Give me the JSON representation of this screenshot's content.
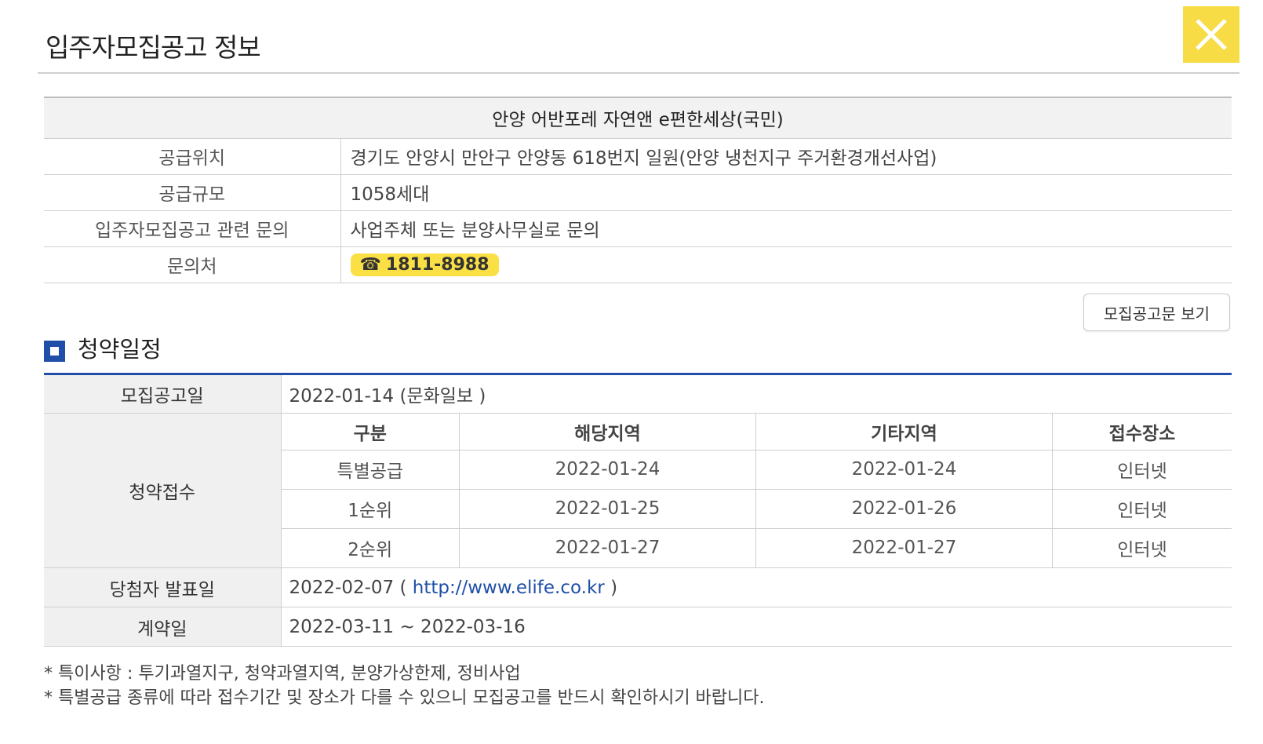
{
  "header": {
    "title": "입주자모집공고 정보"
  },
  "info": {
    "complex_name": "안양 어반포레 자연앤 e편한세상(국민)",
    "rows": [
      {
        "label": "공급위치",
        "value": "경기도 안양시 만안구 안양동 618번지 일원(안양 냉천지구 주거환경개선사업)"
      },
      {
        "label": "공급규모",
        "value": "1058세대"
      },
      {
        "label": "입주자모집공고 관련 문의",
        "value": "사업주체 또는 분양사무실로 문의"
      }
    ],
    "contact_label": "문의처",
    "phone_icon": "☎",
    "phone": "1811-8988"
  },
  "view_notice_label": "모집공고문 보기",
  "schedule": {
    "section_title": "청약일정",
    "announcement_label": "모집공고일",
    "announcement_value": "2022-01-14 (문화일보 )",
    "subscription_label": "청약접수",
    "columns": [
      "구분",
      "해당지역",
      "기타지역",
      "접수장소"
    ],
    "rows": [
      [
        "특별공급",
        "2022-01-24",
        "2022-01-24",
        "인터넷"
      ],
      [
        "1순위",
        "2022-01-25",
        "2022-01-26",
        "인터넷"
      ],
      [
        "2순위",
        "2022-01-27",
        "2022-01-27",
        "인터넷"
      ]
    ],
    "winner_label": "당첨자 발표일",
    "winner_date": "2022-02-07 (",
    "winner_link": "http://www.elife.co.kr",
    "winner_close": ")",
    "contract_label": "계약일",
    "contract_value": "2022-03-11 ~ 2022-03-16"
  },
  "notes": [
    "* 특이사항 : 투기과열지구, 청약과열지역, 분양가상한제, 정비사업",
    "* 특별공급 종류에 따라 접수기간 및 장소가 다를 수 있으니 모집공고를 반드시 확인하시기 바랍니다."
  ],
  "colors": {
    "accent_blue": "#1f4fa8",
    "highlight_yellow": "#f8dc45"
  }
}
